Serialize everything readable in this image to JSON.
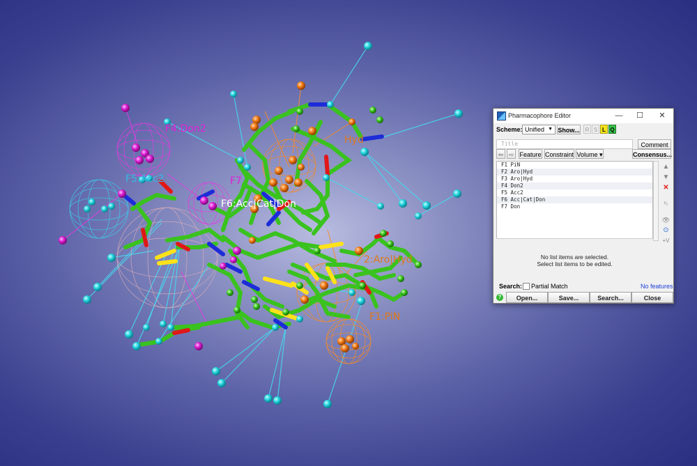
{
  "viewer": {
    "labels": [
      {
        "text": "F4:Don2",
        "color": "#e020d8"
      },
      {
        "text": "F5:Acc2",
        "color": "#38b8e8"
      },
      {
        "text": "F6:Acc|Cat|Don",
        "color": "#ffffff"
      },
      {
        "text": "F7",
        "color": "#e020d8"
      },
      {
        "text": "Hyd",
        "color": "#e07818"
      },
      {
        "text": "2:Aro|Hyd",
        "color": "#e07818"
      },
      {
        "text": "F1:PiN",
        "color": "#e07818"
      }
    ],
    "colors": {
      "carbon": "#3ac21e",
      "nitrogen": "#1d2cd8",
      "oxygen": "#e01818",
      "sulfur": "#ffe21a",
      "hydrogen_ball": "#22d2de",
      "donor": "#d81ad0",
      "aromatic": "#f07814"
    }
  },
  "dialog": {
    "title": "Pharmacophore Editor",
    "window_buttons": {
      "minimize": "—",
      "maximize": "☐",
      "close": "✕"
    },
    "scheme_label": "Scheme:",
    "scheme_value": "Unified",
    "show_label": "Show...",
    "toggles": [
      "R",
      "S",
      "L",
      "Q"
    ],
    "title_placeholder": "Title",
    "comment_label": "Comment",
    "nav_back": "⇦",
    "nav_forward": "⇨",
    "feature_label": "Feature",
    "constraint_label": "Constraint",
    "volume_label": "Volume ▾",
    "consensus_label": "Consensus...",
    "features": [
      "F1 PiN",
      "F2 Aro|Hyd",
      "F3 Aro|Hyd",
      "F4 Don2",
      "F5 Acc2",
      "F6 Acc|Cat|Don",
      "F7 Don"
    ],
    "side_tools": [
      "▲",
      "▼",
      "✕",
      "¹⁄₂",
      "👁",
      "⊙",
      "+V"
    ],
    "no_selection_line1": "No list items are selected.",
    "no_selection_line2": "Select list items to be edited.",
    "search_label": "Search:",
    "partial_match_label": "Partial Match",
    "no_features_label": "No features",
    "help_icon": "?",
    "buttons": {
      "open": "Open...",
      "save": "Save...",
      "search": "Search...",
      "close": "Close"
    }
  }
}
